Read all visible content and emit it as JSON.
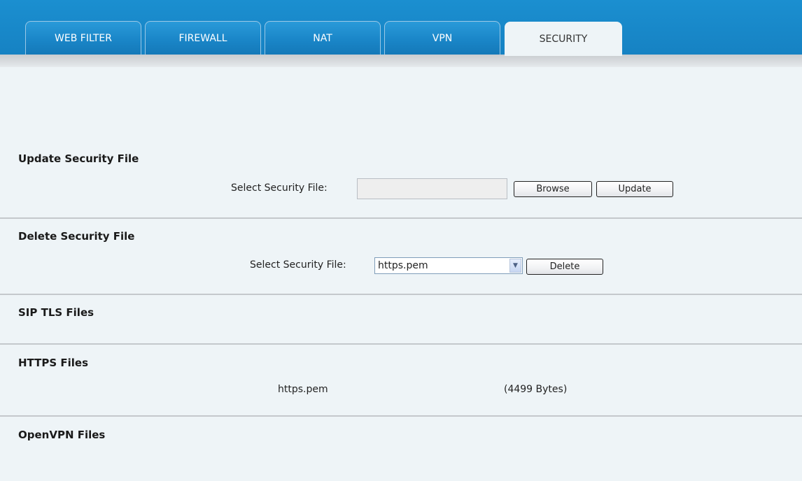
{
  "tabs": [
    {
      "label": "WEB FILTER",
      "active": false
    },
    {
      "label": "FIREWALL",
      "active": false
    },
    {
      "label": "NAT",
      "active": false
    },
    {
      "label": "VPN",
      "active": false
    },
    {
      "label": "SECURITY",
      "active": true
    }
  ],
  "update_section": {
    "title": "Update Security File",
    "field_label": "Select Security File:",
    "file_value": "",
    "browse_label": "Browse",
    "update_label": "Update"
  },
  "delete_section": {
    "title": "Delete Security File",
    "field_label": "Select Security File:",
    "selected_file": "https.pem",
    "delete_label": "Delete"
  },
  "sip_tls_section": {
    "title": "SIP TLS Files",
    "files": []
  },
  "https_section": {
    "title": "HTTPS Files",
    "files": [
      {
        "name": "https.pem",
        "size": "(4499 Bytes)"
      }
    ]
  },
  "openvpn_section": {
    "title": "OpenVPN Files",
    "files": []
  },
  "colors": {
    "header_blue": "#1b8fd0",
    "page_background": "#eef4f7",
    "divider": "#c4c8cc"
  }
}
